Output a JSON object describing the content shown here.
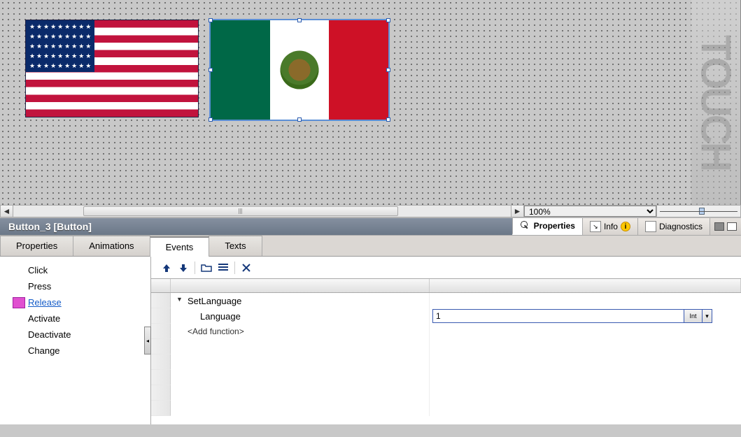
{
  "watermark": "TOUCH",
  "canvas": {
    "objects": [
      {
        "type": "flag-usa",
        "selected": false
      },
      {
        "type": "flag-mexico",
        "selected": true
      }
    ]
  },
  "zoom": {
    "value": "100%",
    "scroll_left": "◄",
    "scroll_right": "►"
  },
  "inspector": {
    "object_label": "Button_3 [Button]",
    "dock_tabs": {
      "properties": "Properties",
      "info": "Info",
      "diagnostics": "Diagnostics"
    },
    "info_badge": "i",
    "sub_tabs": {
      "properties": "Properties",
      "animations": "Animations",
      "events": "Events",
      "texts": "Texts"
    },
    "active_sub_tab": "events"
  },
  "events": {
    "list": {
      "click": "Click",
      "press": "Press",
      "release": "Release",
      "activate": "Activate",
      "deactivate": "Deactivate",
      "change": "Change"
    },
    "selected": "release",
    "toolbar": {
      "move_up": "↥",
      "move_down": "↧",
      "open": "⤴",
      "indent": "⇥",
      "delete": "✕"
    },
    "function": {
      "name": "SetLanguage",
      "params": [
        {
          "label": "Language",
          "value": "1",
          "type_btn": "Int"
        }
      ],
      "add_placeholder": "<Add function>"
    }
  }
}
